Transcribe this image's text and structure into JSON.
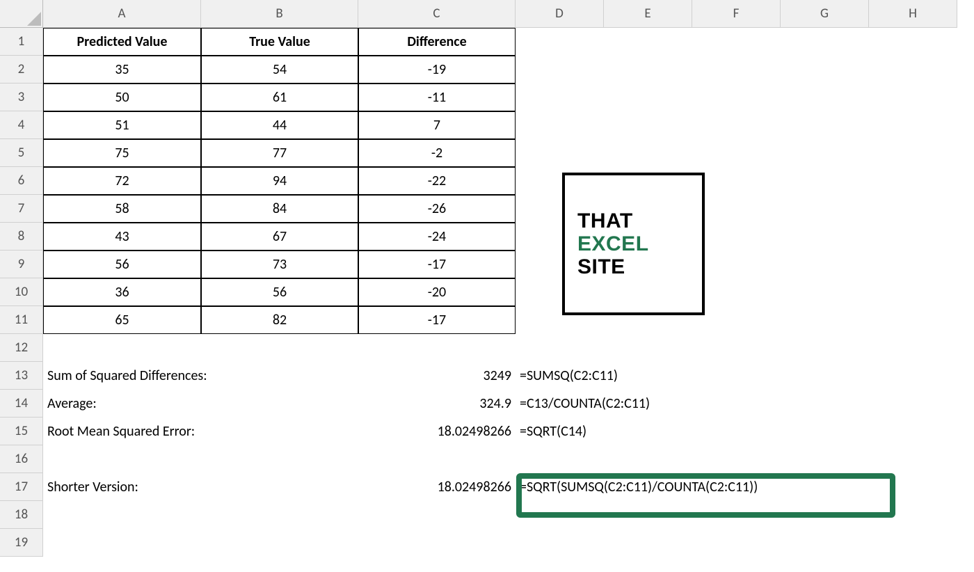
{
  "columns": [
    "A",
    "B",
    "C",
    "D",
    "E",
    "F",
    "G",
    "H"
  ],
  "row_numbers": [
    "1",
    "2",
    "3",
    "4",
    "5",
    "6",
    "7",
    "8",
    "9",
    "10",
    "11",
    "12",
    "13",
    "14",
    "15",
    "16",
    "17",
    "18",
    "19"
  ],
  "table": {
    "headers": [
      "Predicted Value",
      "True Value",
      "Difference"
    ],
    "rows": [
      [
        "35",
        "54",
        "-19"
      ],
      [
        "50",
        "61",
        "-11"
      ],
      [
        "51",
        "44",
        "7"
      ],
      [
        "75",
        "77",
        "-2"
      ],
      [
        "72",
        "94",
        "-22"
      ],
      [
        "58",
        "84",
        "-26"
      ],
      [
        "43",
        "67",
        "-24"
      ],
      [
        "56",
        "73",
        "-17"
      ],
      [
        "36",
        "56",
        "-20"
      ],
      [
        "65",
        "82",
        "-17"
      ]
    ]
  },
  "summary": {
    "ssd_label": "Sum of Squared Differences:",
    "ssd_value": "3249",
    "ssd_formula": "=SUMSQ(C2:C11)",
    "avg_label": "Average:",
    "avg_value": "324.9",
    "avg_formula": "=C13/COUNTA(C2:C11)",
    "rmse_label": "Root Mean Squared Error:",
    "rmse_value": "18.02498266",
    "rmse_formula": "=SQRT(C14)",
    "short_label": "Shorter Version:",
    "short_value": "18.02498266",
    "short_formula": "=SQRT(SUMSQ(C2:C11)/COUNTA(C2:C11))"
  },
  "logo": {
    "line1": "THAT",
    "line2": "EXCEL",
    "line3": "SITE"
  },
  "chart_data": {
    "type": "table",
    "title": "RMSE calculation example",
    "columns": [
      "Predicted Value",
      "True Value",
      "Difference"
    ],
    "rows": [
      [
        35,
        54,
        -19
      ],
      [
        50,
        61,
        -11
      ],
      [
        51,
        44,
        7
      ],
      [
        75,
        77,
        -2
      ],
      [
        72,
        94,
        -22
      ],
      [
        58,
        84,
        -26
      ],
      [
        43,
        67,
        -24
      ],
      [
        56,
        73,
        -17
      ],
      [
        36,
        56,
        -20
      ],
      [
        65,
        82,
        -17
      ]
    ],
    "derived": {
      "sum_of_squared_differences": 3249,
      "average": 324.9,
      "root_mean_squared_error": 18.02498266
    }
  }
}
